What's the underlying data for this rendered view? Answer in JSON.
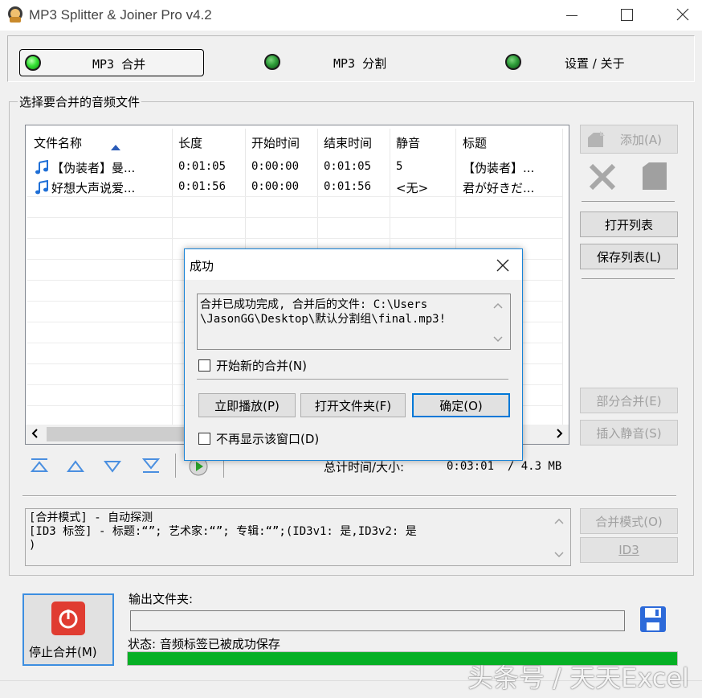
{
  "window": {
    "title": "MP3 Splitter & Joiner Pro v4.2"
  },
  "tabs": [
    {
      "label": "MP3 合并",
      "active": true
    },
    {
      "label": "MP3 分割",
      "active": false
    },
    {
      "label": "设置 / 关于",
      "active": false
    }
  ],
  "join": {
    "group_label": "选择要合并的音频文件",
    "columns": [
      "文件名称",
      "长度",
      "开始时间",
      "结束时间",
      "静音",
      "标题"
    ],
    "rows": [
      {
        "name": "【伪装者】曼...",
        "length": "0:01:05",
        "start": "0:00:00",
        "end": "0:01:05",
        "silence": "5",
        "title": "【伪装者】..."
      },
      {
        "name": "好想大声说爱...",
        "length": "0:01:56",
        "start": "0:00:00",
        "end": "0:01:56",
        "silence": "<无>",
        "title": "君が好きだ..."
      }
    ],
    "side_buttons": {
      "add": "添加(A)",
      "open_list": "打开列表",
      "save_list": "保存列表(L)",
      "part_join": "部分合并(E)",
      "insert_silence": "插入静音(S)",
      "join_mode": "合并模式(O)",
      "id3": "ID3"
    },
    "total_label": "总计时间/大小:",
    "total_value": "0:03:01  / 4.3 MB",
    "info_lines": [
      "[合并模式] - 自动探测",
      "[ID3 标签] - 标题:“”; 艺术家:“”; 专辑:“”;(ID3v1: 是,ID3v2: 是",
      ")"
    ]
  },
  "bottom": {
    "stop_button": "停止合并(M)",
    "output_label": "输出文件夹:",
    "output_value": "",
    "status": "状态: 音频标签已被成功保存",
    "progress": 1.0
  },
  "dialog": {
    "title": "成功",
    "message_line1": "合并已成功完成, 合并后的文件: C:\\Users",
    "message_line2": "\\JasonGG\\Desktop\\默认分割组\\final.mp3!",
    "check_new": "开始新的合并(N)",
    "btn_play": "立即播放(P)",
    "btn_open_folder": "打开文件夹(F)",
    "btn_ok": "确定(O)",
    "check_no_show": "不再显示该窗口(D)"
  },
  "watermark": "头条号 / 天天Excel",
  "colors": {
    "accent": "#0078d7",
    "progress": "#06b025",
    "stop_red": "#e03c31"
  }
}
